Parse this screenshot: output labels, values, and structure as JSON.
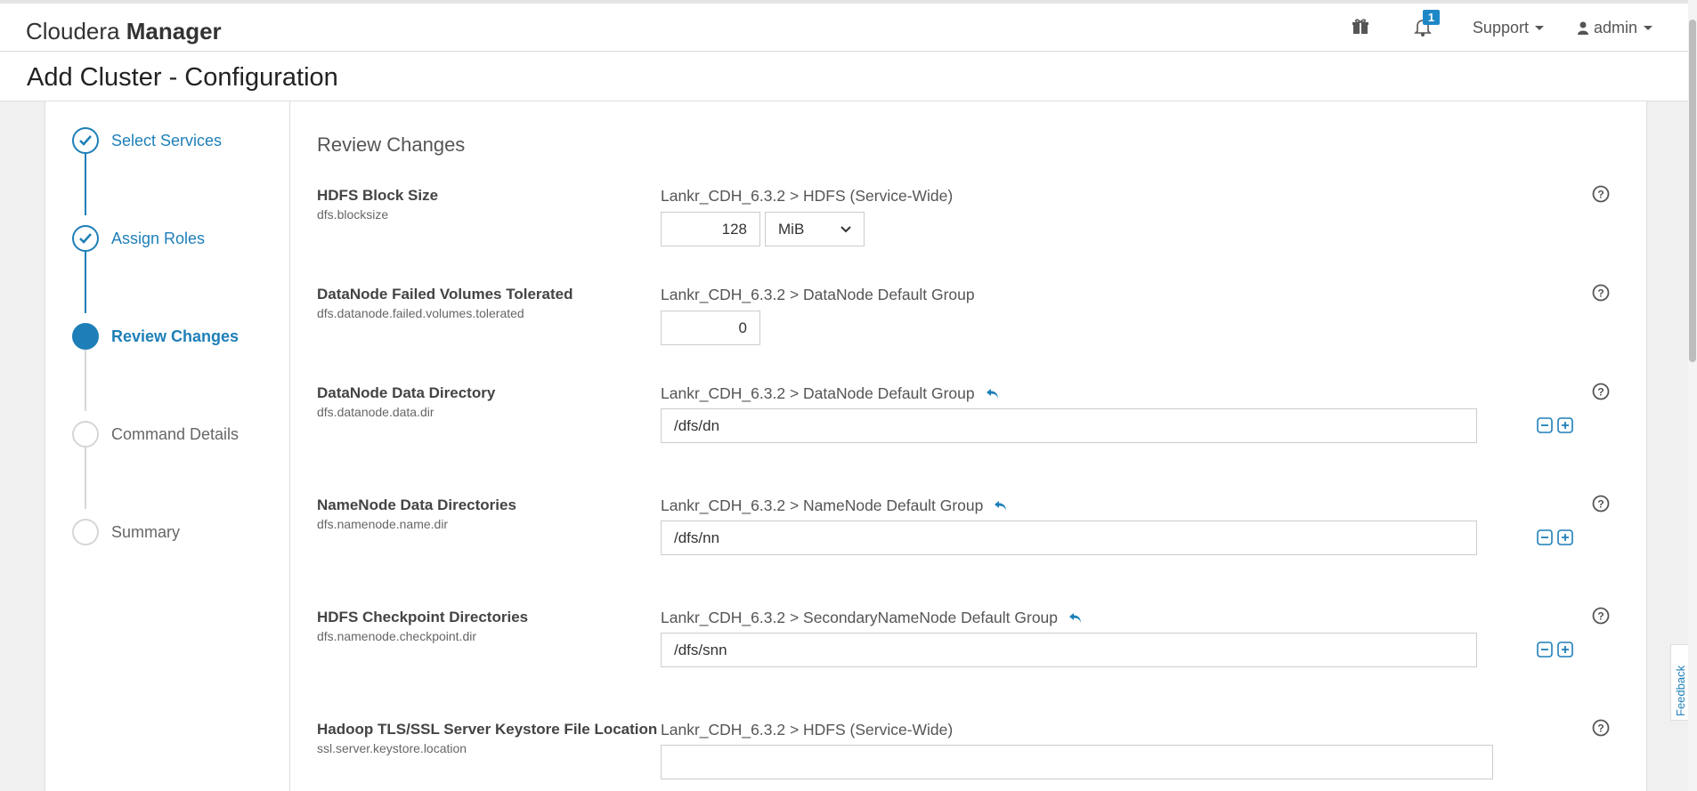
{
  "app": {
    "brand_light": "Cloudera",
    "brand_bold": "Manager",
    "notification_count": "1",
    "support_label": "Support",
    "user_label": "admin"
  },
  "page": {
    "title": "Add Cluster - Configuration"
  },
  "wizard": {
    "steps": [
      {
        "label": "Select Services",
        "state": "done"
      },
      {
        "label": "Assign Roles",
        "state": "done"
      },
      {
        "label": "Review Changes",
        "state": "active"
      },
      {
        "label": "Command Details",
        "state": "pending"
      },
      {
        "label": "Summary",
        "state": "pending"
      }
    ]
  },
  "content": {
    "section_title": "Review Changes",
    "properties": [
      {
        "name": "HDFS Block Size",
        "key": "dfs.blocksize",
        "scope": "Lankr_CDH_6.3.2 > HDFS (Service-Wide)",
        "value": "128",
        "unit": "MiB",
        "undo": false
      },
      {
        "name": "DataNode Failed Volumes Tolerated",
        "key": "dfs.datanode.failed.volumes.tolerated",
        "scope": "Lankr_CDH_6.3.2 > DataNode Default Group",
        "value": "0",
        "undo": false
      },
      {
        "name": "DataNode Data Directory",
        "key": "dfs.datanode.data.dir",
        "scope": "Lankr_CDH_6.3.2 > DataNode Default Group",
        "value": "/dfs/dn",
        "undo": true
      },
      {
        "name": "NameNode Data Directories",
        "key": "dfs.namenode.name.dir",
        "scope": "Lankr_CDH_6.3.2 > NameNode Default Group",
        "value": "/dfs/nn",
        "undo": true
      },
      {
        "name": "HDFS Checkpoint Directories",
        "key": "dfs.namenode.checkpoint.dir",
        "scope": "Lankr_CDH_6.3.2 > SecondaryNameNode Default Group",
        "value": "/dfs/snn",
        "undo": true
      },
      {
        "name": "Hadoop TLS/SSL Server Keystore File Location",
        "key": "ssl.server.keystore.location",
        "scope": "Lankr_CDH_6.3.2 > HDFS (Service-Wide)",
        "value": "",
        "undo": false
      }
    ]
  },
  "feedback_label": "Feedback",
  "colors": {
    "accent": "#1e7fb8",
    "badge": "#1e88c7"
  }
}
